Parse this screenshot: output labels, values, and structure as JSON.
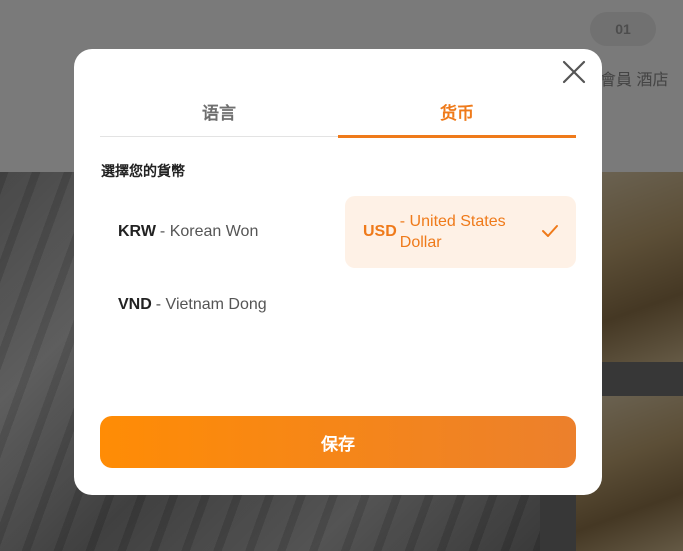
{
  "background": {
    "top_right_badge": "01",
    "top_right_text": "會員 酒店"
  },
  "modal": {
    "close_icon": "close-icon",
    "tabs": [
      {
        "label": "语言",
        "active": false
      },
      {
        "label": "货币",
        "active": true
      }
    ],
    "section_title": "選擇您的貨幣",
    "currencies": [
      {
        "code": "KRW",
        "name": "- Korean Won",
        "selected": false
      },
      {
        "code": "USD",
        "name": "- United States Dollar",
        "selected": true
      },
      {
        "code": "VND",
        "name": "- Vietnam Dong",
        "selected": false
      }
    ],
    "save_label": "保存",
    "accent_color": "#ef7a1a",
    "selected_bg_color": "#fef1e6"
  }
}
